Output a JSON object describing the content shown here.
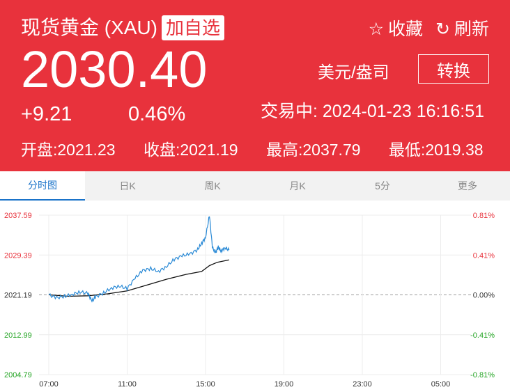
{
  "header": {
    "title": "现货黄金 (XAU)",
    "add_watch": "加自选",
    "favorite_label": "收藏",
    "refresh_label": "刷新",
    "price": "2030.40",
    "unit": "美元/盎司",
    "convert_label": "转换",
    "change": "+9.21",
    "change_percent": "0.46%",
    "trading_label": "交易中:",
    "timestamp": "2024-01-23 16:16:51",
    "stats": [
      {
        "label": "开盘:",
        "value": "2021.23"
      },
      {
        "label": "收盘:",
        "value": "2021.19"
      },
      {
        "label": "最高:",
        "value": "2037.79"
      },
      {
        "label": "最低:",
        "value": "2019.38"
      }
    ],
    "bg_color": "#e8323c"
  },
  "tabs": [
    {
      "label": "分时图",
      "active": true
    },
    {
      "label": "日K",
      "active": false
    },
    {
      "label": "周K",
      "active": false
    },
    {
      "label": "月K",
      "active": false
    },
    {
      "label": "5分",
      "active": false
    },
    {
      "label": "更多",
      "active": false
    }
  ],
  "chart_data": {
    "type": "line",
    "y_left_ticks": [
      "2037.59",
      "2029.39",
      "2021.19",
      "2012.99",
      "2004.79"
    ],
    "y_right_ticks": [
      "0.81%",
      "0.41%",
      "0.00%",
      "-0.41%",
      "-0.81%"
    ],
    "x_ticks": [
      "07:00",
      "11:00",
      "15:00",
      "19:00",
      "23:00",
      "05:00"
    ],
    "ylim": [
      2004.79,
      2037.59
    ],
    "baseline": 2021.19,
    "price_series": [
      [
        0,
        2021.2
      ],
      [
        0.4,
        2020.6
      ],
      [
        0.8,
        2020.9
      ],
      [
        1.2,
        2021.3
      ],
      [
        1.6,
        2021.8
      ],
      [
        2.0,
        2021.5
      ],
      [
        2.2,
        2019.9
      ],
      [
        2.4,
        2020.8
      ],
      [
        2.8,
        2021.6
      ],
      [
        3.2,
        2022.6
      ],
      [
        3.6,
        2023.0
      ],
      [
        4.0,
        2022.5
      ],
      [
        4.4,
        2024.6
      ],
      [
        4.8,
        2026.2
      ],
      [
        5.2,
        2026.6
      ],
      [
        5.6,
        2026.0
      ],
      [
        6.0,
        2027.0
      ],
      [
        6.4,
        2028.5
      ],
      [
        6.8,
        2029.2
      ],
      [
        7.2,
        2029.6
      ],
      [
        7.6,
        2030.5
      ],
      [
        7.8,
        2031.8
      ],
      [
        8.0,
        2033.0
      ],
      [
        8.2,
        2037.59
      ],
      [
        8.35,
        2031.0
      ],
      [
        8.5,
        2029.8
      ],
      [
        8.65,
        2031.0
      ],
      [
        8.8,
        2030.2
      ],
      [
        9.0,
        2030.9
      ],
      [
        9.2,
        2030.4
      ]
    ],
    "avg_series": [
      [
        0,
        2021.2
      ],
      [
        1.0,
        2020.9
      ],
      [
        2.0,
        2021.0
      ],
      [
        3.0,
        2021.4
      ],
      [
        4.0,
        2022.0
      ],
      [
        5.0,
        2023.2
      ],
      [
        6.0,
        2024.4
      ],
      [
        7.0,
        2025.4
      ],
      [
        7.8,
        2026.0
      ],
      [
        8.2,
        2027.2
      ],
      [
        8.6,
        2027.9
      ],
      [
        9.2,
        2028.4
      ]
    ],
    "price_color": "#2a8ad6",
    "avg_color": "#111111",
    "up_color": "#e8323c",
    "down_color": "#21a321"
  }
}
